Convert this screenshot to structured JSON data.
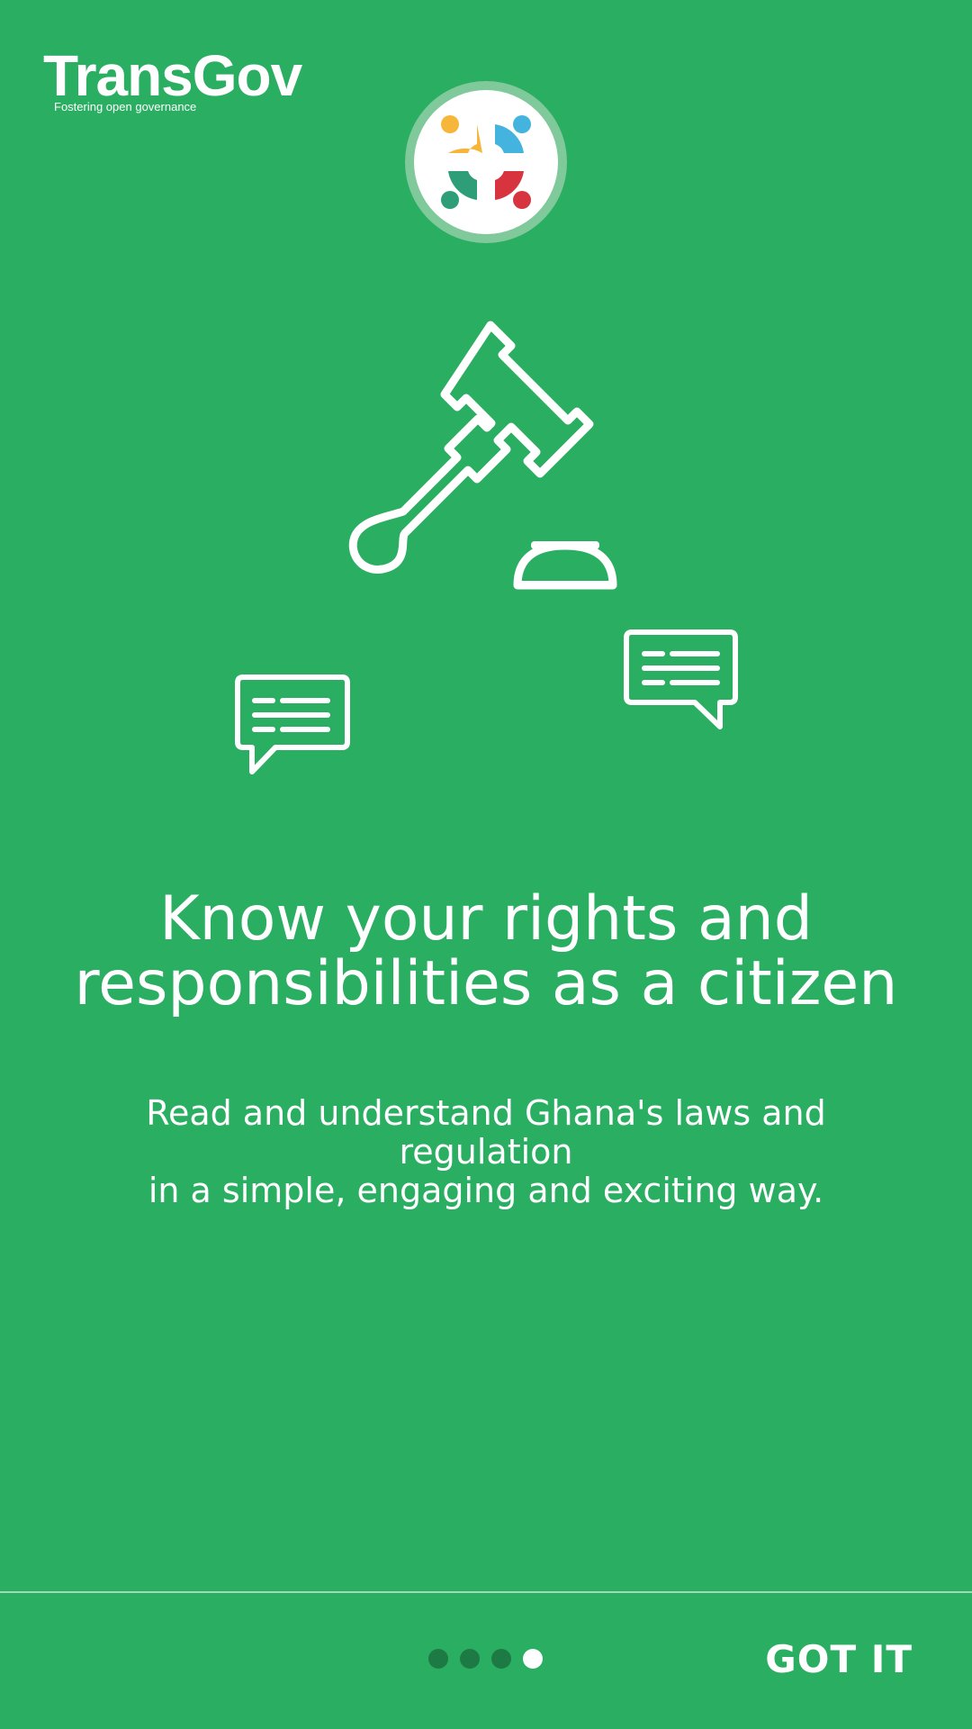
{
  "brand": {
    "name": "TransGov",
    "tagline": "Fostering open governance"
  },
  "logo": {
    "icon": "people-circle-logo-icon"
  },
  "illustration": {
    "icons": [
      "gavel-icon",
      "sound-block-icon",
      "chat-bubble-icon",
      "chat-bubble-icon"
    ]
  },
  "onboarding": {
    "headline_line1": "Know your rights and",
    "headline_line2": "responsibilities as a citizen",
    "subtitle_line1": "Read and understand Ghana's laws and regulation",
    "subtitle_line2": "in a simple, engaging and exciting way.",
    "page_indicator": {
      "total": 4,
      "current": 4
    }
  },
  "footer": {
    "action_label": "GOT IT"
  },
  "colors": {
    "background": "#2aae61",
    "dot_inactive": "#1e7a44",
    "dot_active": "#ffffff"
  }
}
